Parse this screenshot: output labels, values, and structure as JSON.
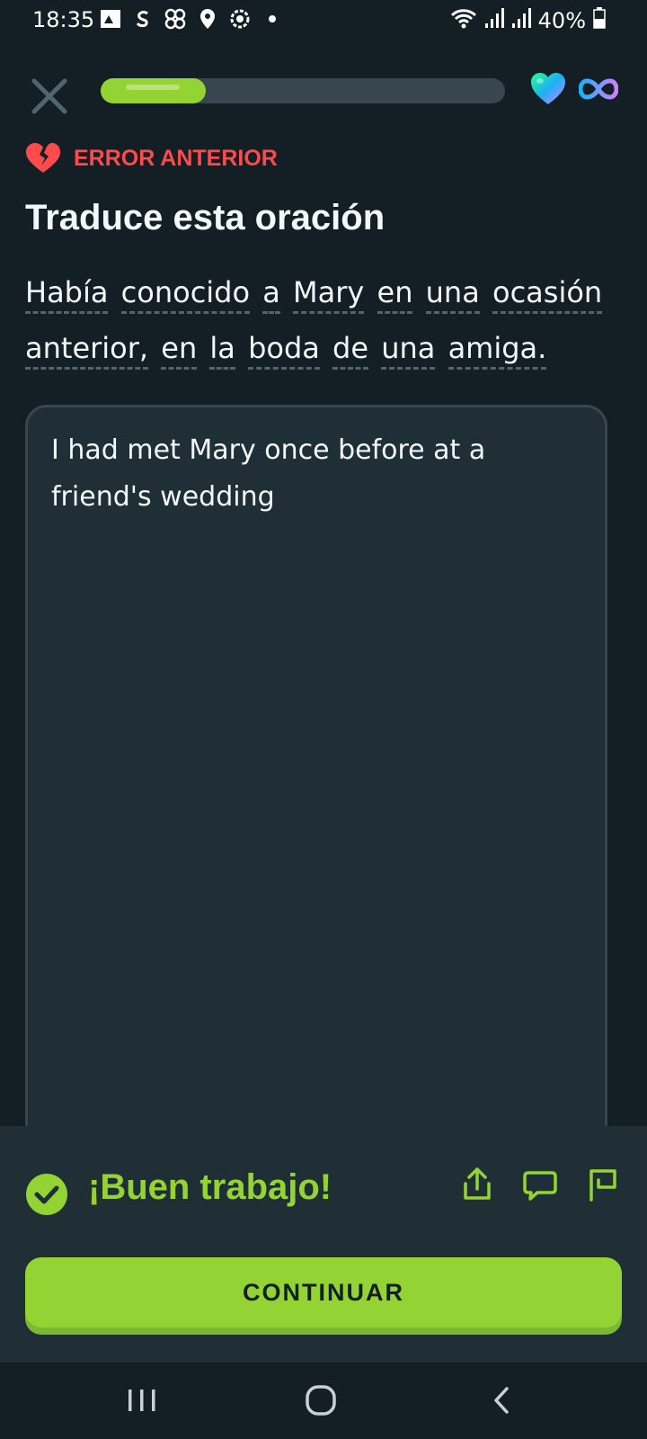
{
  "status_bar": {
    "time": "18:35",
    "battery_percent": "40%",
    "left_icons": [
      "gallery-icon",
      "s-app-icon",
      "pinwheel-icon",
      "location-icon",
      "settings-icon",
      "dot-icon"
    ],
    "right_icons": [
      "wifi-icon",
      "signal-icon",
      "signal-icon",
      "battery-icon"
    ]
  },
  "top_bar": {
    "progress_fraction": 0.26,
    "hearts": "infinite"
  },
  "lesson": {
    "previous_mistake_label": "ERROR ANTERIOR",
    "title": "Traduce esta oración",
    "sentence_words": [
      "Había",
      "conocido",
      "a",
      "Mary",
      "en",
      "una",
      "ocasión",
      "anterior,",
      "en",
      "la",
      "boda",
      "de",
      "una",
      "amiga."
    ]
  },
  "answer": {
    "text": "I had met Mary once before at a friend's wedding"
  },
  "feedback": {
    "title": "¡Buen trabajo!",
    "continue_label": "CONTINUAR"
  },
  "colors": {
    "background": "#131f24",
    "panel": "#202f36",
    "accent_green": "#93d333",
    "error_red": "#ff4b4b"
  }
}
